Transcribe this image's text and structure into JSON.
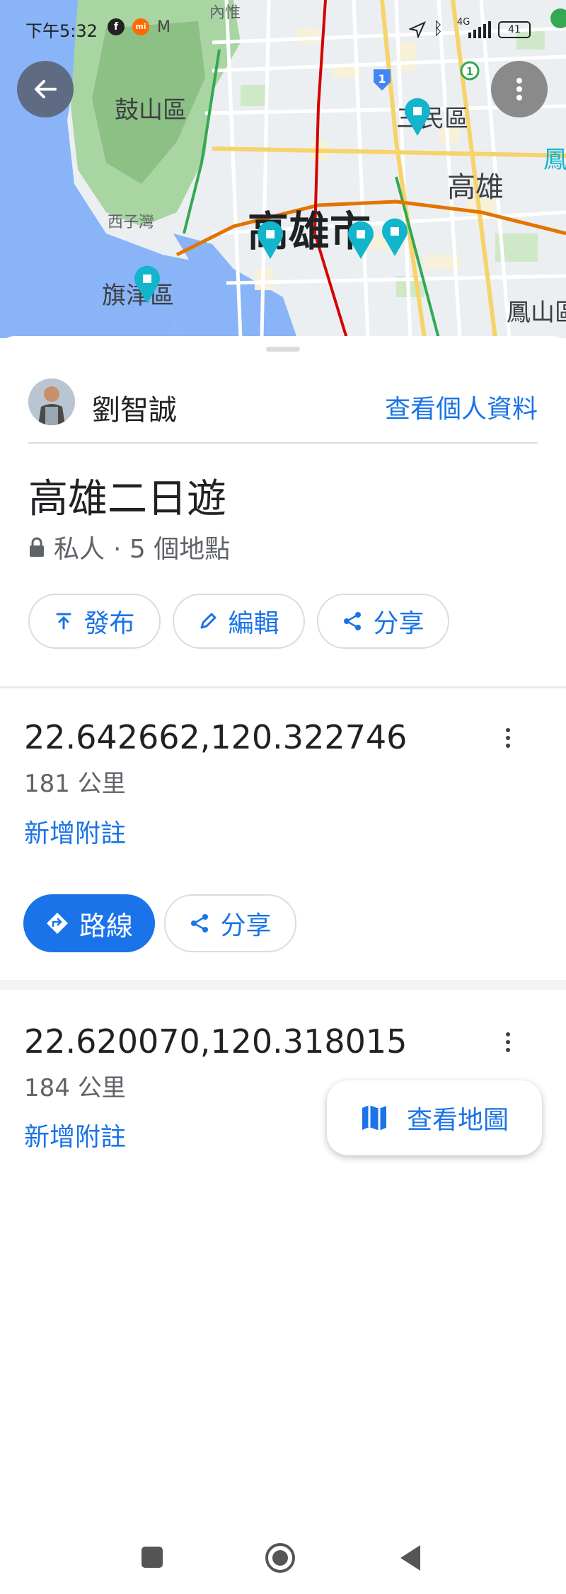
{
  "status_bar": {
    "time": "下午5:32",
    "network": "4G",
    "battery": "41"
  },
  "map": {
    "labels": {
      "neihui": "內惟",
      "gushan": "鼓山區",
      "sanmin": "三民區",
      "kaohsiung_east": "高雄",
      "xiziwan": "西子灣",
      "kaohsiung_city": "高雄市",
      "qijin": "旗津區",
      "fengshan": "鳳山區",
      "feng_edge": "鳳"
    },
    "route_badges": [
      "1",
      "1"
    ],
    "back_button_label": "返回",
    "more_button_label": "更多選項"
  },
  "owner": {
    "name": "劉智誠",
    "profile_link": "查看個人資料"
  },
  "list": {
    "title": "高雄二日遊",
    "privacy": "私人",
    "place_count": "· 5 個地點"
  },
  "actions": {
    "publish": "發布",
    "edit": "編輯",
    "share": "分享"
  },
  "places": [
    {
      "coords": "22.642662,120.322746",
      "distance": "181 公里",
      "add_note": "新增附註",
      "directions": "路線",
      "share": "分享"
    },
    {
      "coords": "22.620070,120.318015",
      "distance": "184 公里",
      "add_note": "新增附註"
    }
  ],
  "view_map_button": "查看地圖",
  "colors": {
    "accent": "#1a73e8",
    "pin": "#12b5cb",
    "route_red": "#d50000",
    "route_orange": "#e37400"
  }
}
